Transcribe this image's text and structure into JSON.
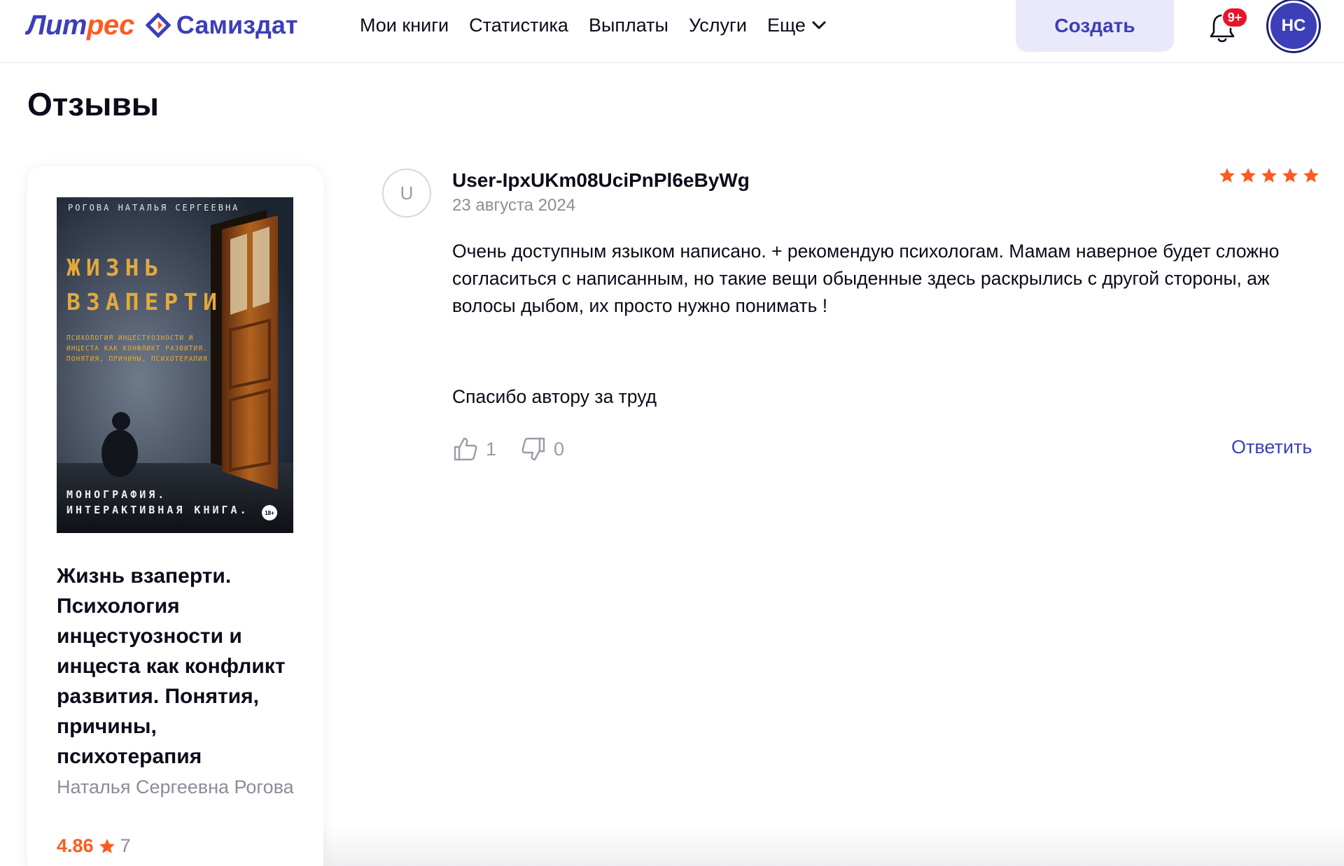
{
  "header": {
    "logo": {
      "part1": "Лит",
      "part2": "рес",
      "part3": "Самиздат"
    },
    "nav": [
      {
        "label": "Мои книги"
      },
      {
        "label": "Статистика"
      },
      {
        "label": "Выплаты"
      },
      {
        "label": "Услуги"
      },
      {
        "label": "Еще"
      }
    ],
    "create_label": "Создать",
    "notifications_badge": "9+",
    "user_initials": "НС"
  },
  "page": {
    "title": "Отзывы"
  },
  "book": {
    "cover": {
      "author": "РОГОВА НАТАЛЬЯ СЕРГЕЕВНА",
      "title": "ЖИЗНЬ\nВЗАПЕРТИ",
      "subtitle": "Психология инцестуозности и инцеста как конфликт развития. Понятия, причины, психотерапия",
      "bottom": "МОНОГРАФИЯ.\nИНТЕРАКТИВНАЯ КНИГА.",
      "age": "18+"
    },
    "title": "Жизнь взаперти. Психология инцестуозности и инцеста как конфликт развития. Понятия, причины, психотерапия",
    "author": "Наталья Сергеевна Рогова",
    "rating": "4.86",
    "rating_count": "7"
  },
  "review": {
    "avatar_letter": "U",
    "user": "User-IpxUKm08UciPnPl6eByWg",
    "date": "23 августа 2024",
    "stars": 5,
    "text": "Очень доступным языком написано. + рекомендую психологам. Мамам наверное будет сложно согласиться с написанным, но такие вещи обыденные здесь раскрылись с другой стороны, аж волосы дыбом, их просто нужно понимать !",
    "thanks": "Спасибо автору за труд",
    "likes": "1",
    "dislikes": "0",
    "reply_label": "Ответить"
  },
  "colors": {
    "brand": "#3c3fb8",
    "accent": "#ff5a1f",
    "badge": "#e8132b"
  }
}
